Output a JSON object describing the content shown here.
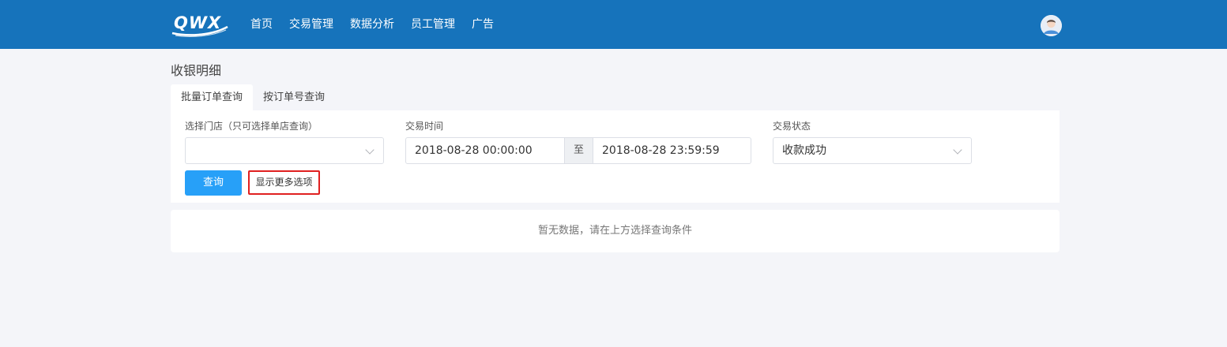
{
  "header": {
    "logo_text": "QWX",
    "nav": [
      "首页",
      "交易管理",
      "数据分析",
      "员工管理",
      "广告"
    ],
    "colors": {
      "bar": "#1673bb",
      "primary_button": "#27a0f8",
      "highlight_border": "#e02020"
    }
  },
  "page": {
    "title": "收银明细",
    "tabs": [
      "批量订单查询",
      "按订单号查询"
    ],
    "active_tab": "批量订单查询"
  },
  "filters": {
    "store": {
      "label": "选择门店（只可选择单店查询）",
      "value": ""
    },
    "time": {
      "label": "交易时间",
      "start": "2018-08-28 00:00:00",
      "separator": "至",
      "end": "2018-08-28 23:59:59"
    },
    "status": {
      "label": "交易状态",
      "value": "收款成功"
    }
  },
  "actions": {
    "query_label": "查询",
    "more_options_label": "显示更多选项"
  },
  "results": {
    "empty_message": "暂无数据，请在上方选择查询条件"
  }
}
